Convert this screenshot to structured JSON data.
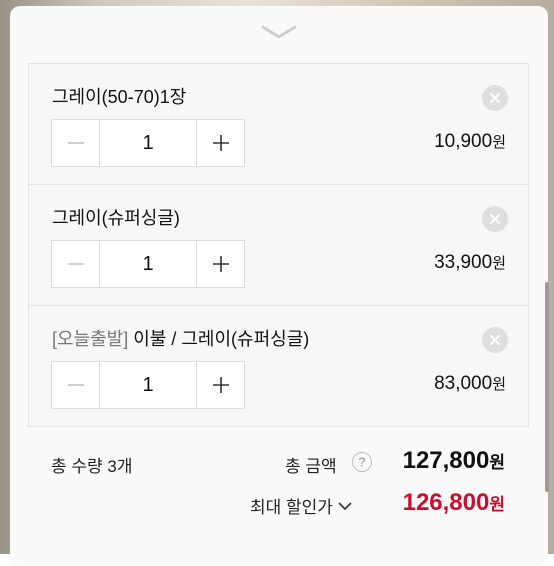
{
  "items": [
    {
      "name": "그레이(50-70)1장",
      "tag": "",
      "quantity": "1",
      "price": "10,900",
      "currency": "원"
    },
    {
      "name": "그레이(슈퍼싱글)",
      "tag": "",
      "quantity": "1",
      "price": "33,900",
      "currency": "원"
    },
    {
      "name": " 이불 / 그레이(슈퍼싱글)",
      "tag": "[오늘출발]",
      "quantity": "1",
      "price": "83,000",
      "currency": "원"
    }
  ],
  "summary": {
    "total_qty_label": "총 수량 3개",
    "total_label": "총 금액",
    "help_glyph": "?",
    "total_amount": "127,800",
    "currency": "원",
    "discount_label": "최대 할인가",
    "discount_amount": "126,800"
  },
  "icons": {
    "handle": "chevron-down-icon",
    "remove": "close-icon",
    "minus": "minus-icon",
    "plus": "plus-icon"
  },
  "colors": {
    "discount": "#c8102e",
    "tag": "#777777"
  }
}
